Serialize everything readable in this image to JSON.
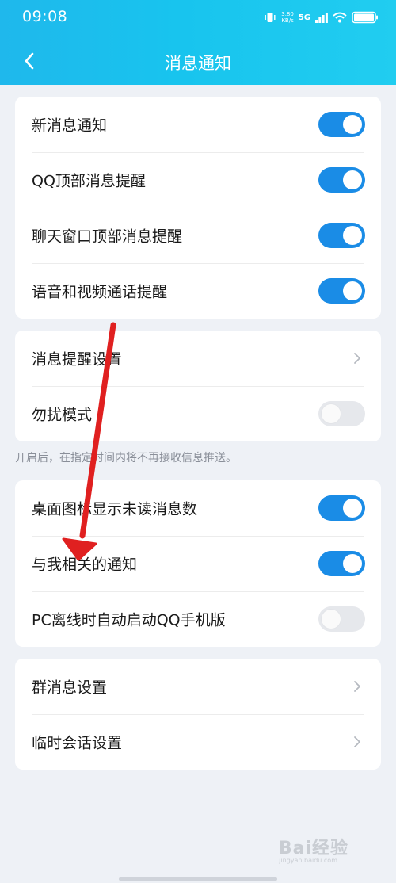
{
  "status_bar": {
    "time": "09:08",
    "net_speed_value": "3.80",
    "net_speed_unit": "KB/s",
    "network_type": "5G"
  },
  "nav": {
    "title": "消息通知"
  },
  "section1": {
    "items": [
      {
        "label": "新消息通知",
        "on": true
      },
      {
        "label": "QQ顶部消息提醒",
        "on": true
      },
      {
        "label": "聊天窗口顶部消息提醒",
        "on": true
      },
      {
        "label": "语音和视频通话提醒",
        "on": true
      }
    ]
  },
  "section2": {
    "reminder_settings_label": "消息提醒设置",
    "dnd_label": "勿扰模式",
    "dnd_on": false,
    "hint": "开启后，在指定时间内将不再接收信息推送。"
  },
  "section3": {
    "items": [
      {
        "label": "桌面图标显示未读消息数",
        "on": true
      },
      {
        "label": "与我相关的通知",
        "on": true
      },
      {
        "label": "PC离线时自动启动QQ手机版",
        "on": false
      }
    ]
  },
  "section4": {
    "group_settings_label": "群消息设置",
    "temp_chat_label": "临时会话设置"
  },
  "watermark": {
    "logo": "Bai经验",
    "url": "jingyan.baidu.com"
  },
  "colors": {
    "header_gradient_start": "#1fb8ec",
    "header_gradient_end": "#21cdf0",
    "toggle_on": "#1a8ce6",
    "toggle_off": "#e6e8ec",
    "annotation_arrow": "#e02020"
  },
  "icons": {
    "back": "chevron-left-icon",
    "row_arrow": "chevron-right-icon"
  }
}
